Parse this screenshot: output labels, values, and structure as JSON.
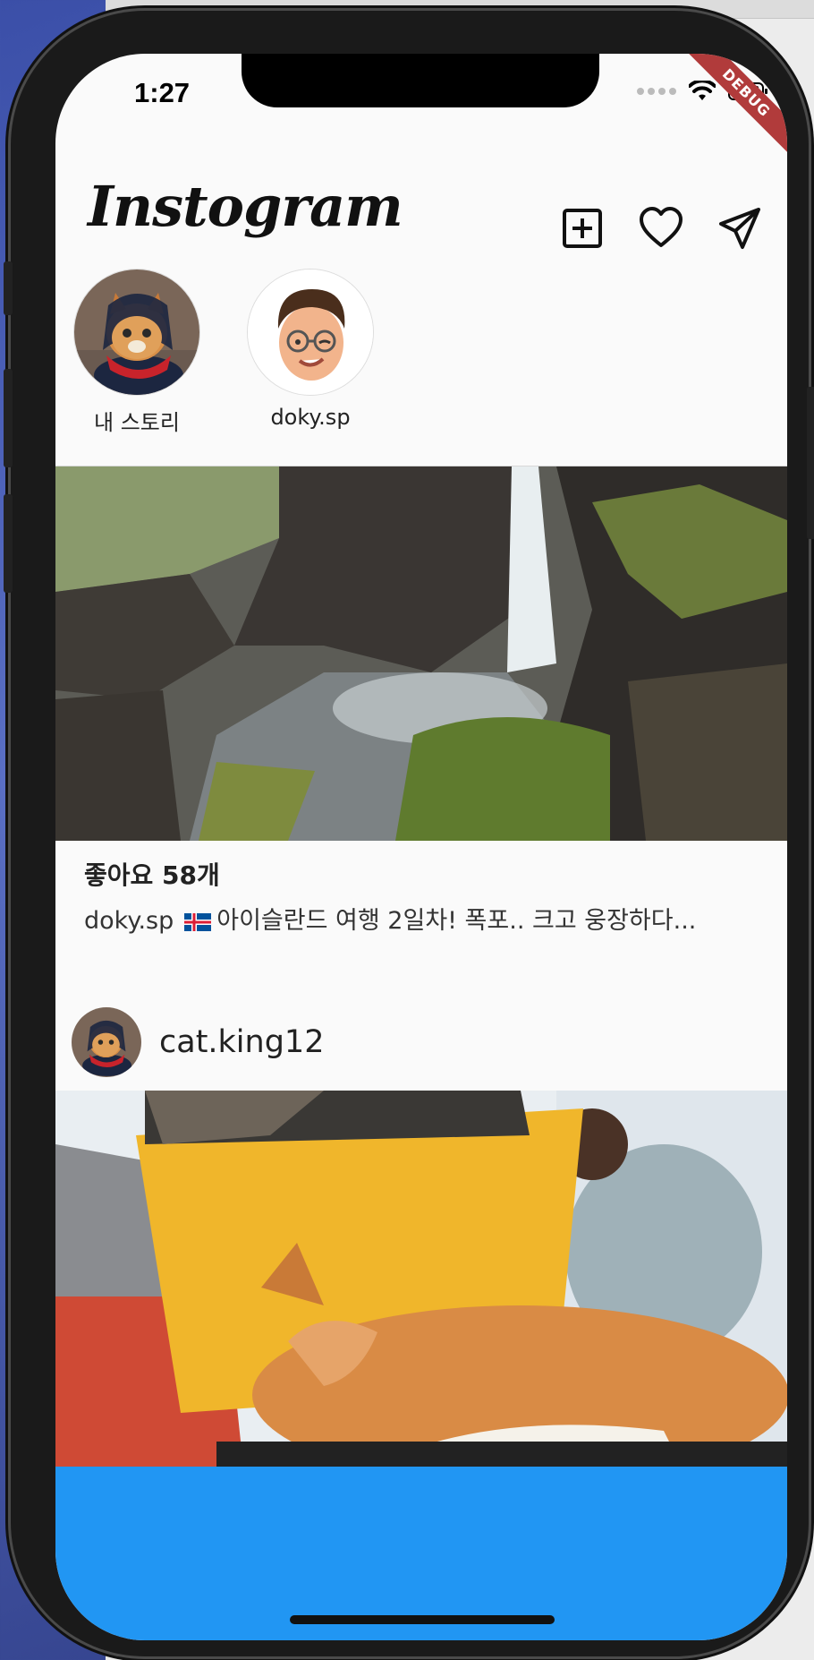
{
  "status_bar": {
    "time": "1:27",
    "debug_label": "DEBUG"
  },
  "header": {
    "logo_text": "Instogram"
  },
  "toolbar": {
    "icons": [
      "add-post-icon",
      "heart-icon",
      "send-icon"
    ]
  },
  "stories": [
    {
      "label": "내 스토리",
      "avatar": "cat-avatar"
    },
    {
      "label": "doky.sp",
      "avatar": "memoji-avatar"
    }
  ],
  "posts": [
    {
      "image": "waterfall-image",
      "likes": "좋아요 58개",
      "caption_user": "doky.sp",
      "caption_text": "아이슬란드 여행 2일차! 폭포.. 크고 웅장하다..."
    },
    {
      "username": "cat.king12",
      "image": "cat-bag-image"
    }
  ],
  "colors": {
    "bottom_bar": "#2196f3",
    "debug": "#b13b3b"
  }
}
